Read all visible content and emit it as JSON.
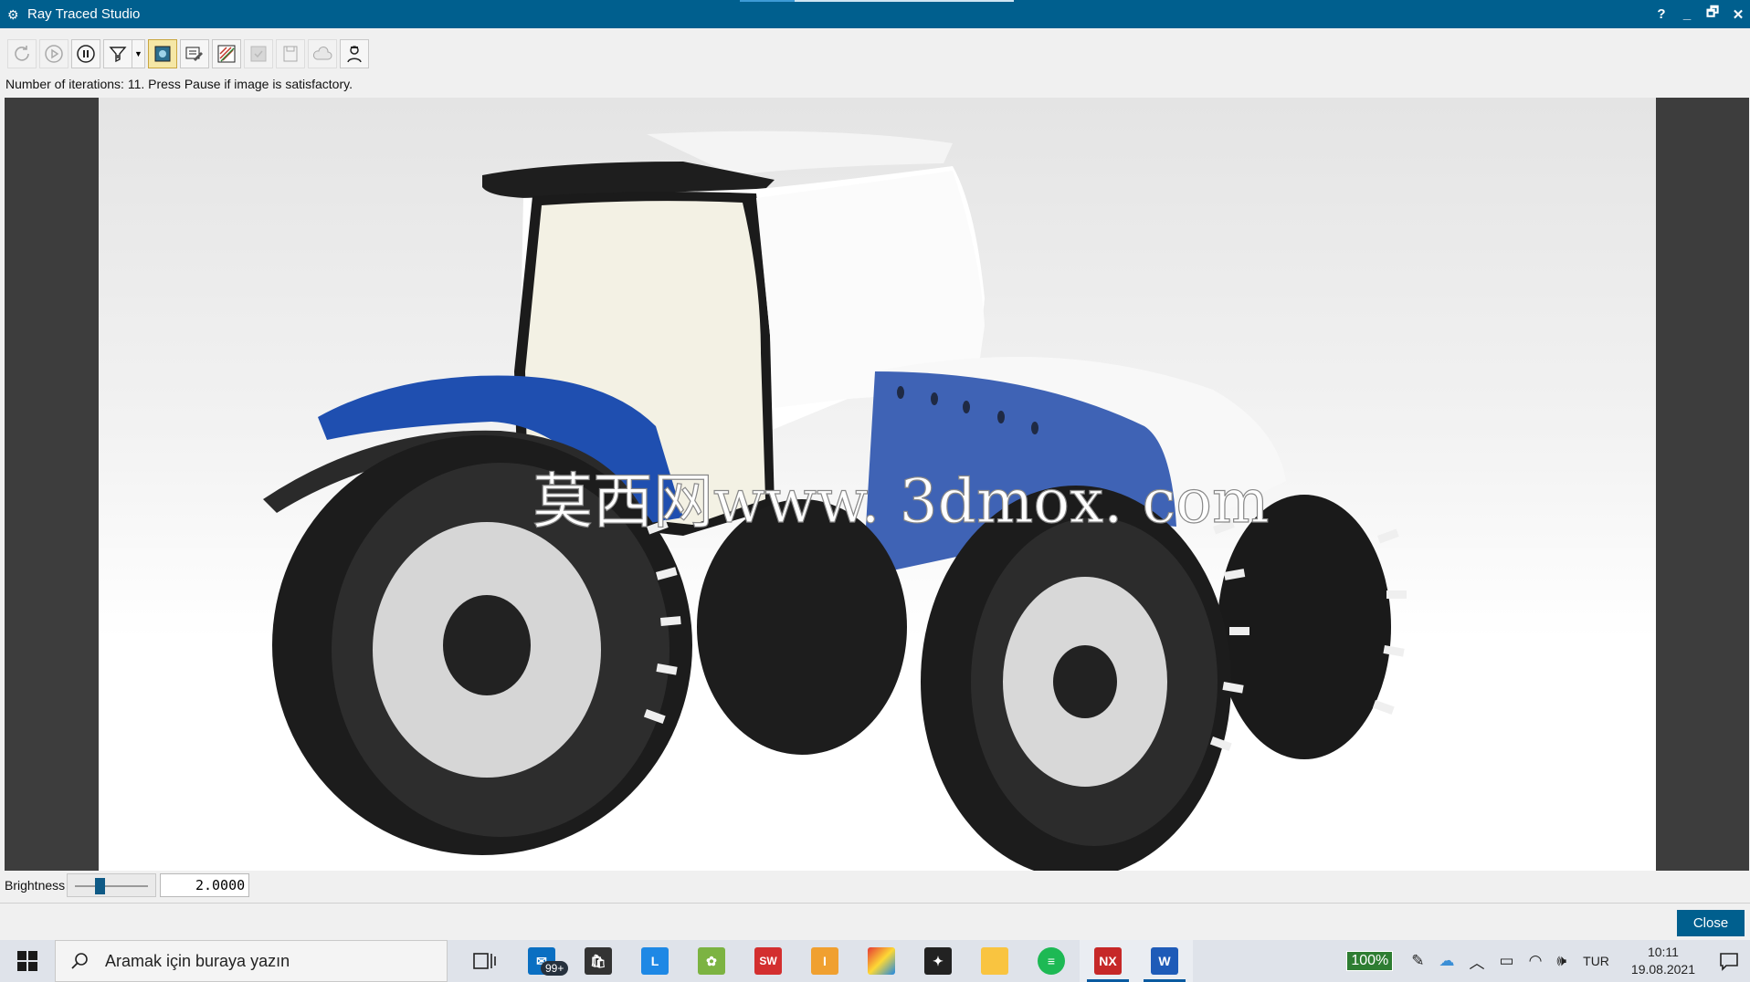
{
  "window": {
    "title": "Ray Traced Studio",
    "controls": {
      "help": "?",
      "minimize": "_",
      "restore": "🗗",
      "close": "✕"
    }
  },
  "toolbar": {
    "buttons": [
      {
        "name": "refresh-button",
        "icon": "refresh-icon",
        "enabled": false
      },
      {
        "name": "start-button",
        "icon": "play-icon",
        "enabled": false
      },
      {
        "name": "pause-button",
        "icon": "pause-icon",
        "enabled": true
      },
      {
        "name": "filter-button",
        "icon": "funnel-icon",
        "enabled": true
      },
      {
        "name": "display-image-button",
        "icon": "image-icon",
        "enabled": true
      },
      {
        "name": "edit-scene-button",
        "icon": "edit-scene-icon",
        "enabled": true
      },
      {
        "name": "edit-properties-button",
        "icon": "pencil-hatch-icon",
        "enabled": true
      },
      {
        "name": "apply-button",
        "icon": "check-icon",
        "enabled": false
      },
      {
        "name": "save-image-button",
        "icon": "save-icon",
        "enabled": false
      },
      {
        "name": "background-button",
        "icon": "cloud-icon",
        "enabled": false
      },
      {
        "name": "camera-button",
        "icon": "person-icon",
        "enabled": true
      }
    ]
  },
  "status": {
    "message": "Number of iterations: 11.  Press Pause if image is satisfactory."
  },
  "render": {
    "watermark": "莫西网www. 3dmox. com"
  },
  "brightness": {
    "label": "Brightness",
    "value": "2.0000",
    "slider_fraction": 0.35
  },
  "dialog": {
    "close_label": "Close"
  },
  "taskbar": {
    "search_placeholder": "Aramak için buraya yazın",
    "mail_badge": "99+",
    "apps": [
      {
        "name": "task-view-icon",
        "label": ""
      },
      {
        "name": "mail-app",
        "label": ""
      },
      {
        "name": "store-app",
        "label": ""
      },
      {
        "name": "l-app",
        "label": "L"
      },
      {
        "name": "game-app",
        "label": ""
      },
      {
        "name": "solidworks-app",
        "label": "SW"
      },
      {
        "name": "inventor-app",
        "label": "I"
      },
      {
        "name": "colorful-app",
        "label": ""
      },
      {
        "name": "catia-app",
        "label": ""
      },
      {
        "name": "file-explorer-app",
        "label": ""
      },
      {
        "name": "spotify-app",
        "label": ""
      },
      {
        "name": "nx-app",
        "label": "NX"
      },
      {
        "name": "word-app",
        "label": "W"
      }
    ],
    "battery_percent": "100%",
    "language": "TUR",
    "time": "10:11",
    "date": "19.08.2021"
  },
  "colors": {
    "titlebar": "#005f8e",
    "tractor_blue": "#2a56b8",
    "tire": "#1c1c1c"
  }
}
